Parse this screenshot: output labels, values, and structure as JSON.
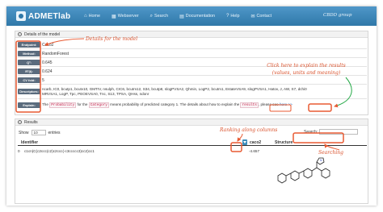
{
  "navbar": {
    "brand": "ADMETlab",
    "items": [
      {
        "icon": "home-icon",
        "glyph": "⌂",
        "label": "Home"
      },
      {
        "icon": "grid-icon",
        "glyph": "▦",
        "label": "Webserver"
      },
      {
        "icon": "search-icon",
        "glyph": "⌕",
        "label": "Search"
      },
      {
        "icon": "book-icon",
        "glyph": "▤",
        "label": "Documentation"
      },
      {
        "icon": "help-icon",
        "glyph": "?",
        "label": "Help"
      },
      {
        "icon": "contact-icon",
        "glyph": "✉",
        "label": "Contact"
      }
    ],
    "language": "CBDD group"
  },
  "details": {
    "header": "Details of the model",
    "rows": {
      "endpoint": {
        "label": "Endpoint:",
        "value": "Caco2"
      },
      "method": {
        "label": "Method:",
        "value": "RandomForest"
      },
      "q2": {
        "label": "Q²:",
        "value": "0.645"
      },
      "r2": {
        "label": "R²(t):",
        "value": "0.624"
      },
      "cv": {
        "label": "CV fold:",
        "value": "5"
      },
      "descriptors": {
        "label": "Descriptors:",
        "line1": "ncarb, IC0, bcutp1, bcutv10, GMTIV, nsulph, CIC6, bcutm12, S34, bcutp8, slogPVSA2, Qhmin, LogP2, bcutm1, EstateVSA9, slogPVSA1, Hatov, J, AW, S7, dchi0",
        "line2": "MRVSA1, LogP, Tpc, PEOEVSA0, Tnc, S13, TPSA, QHss, ndonr"
      },
      "explain": {
        "label": "Explain:",
        "part1": "The",
        "tag1": "Probability",
        "part2": "for the",
        "tag2": "Category",
        "part3": "means probability of predicted category 1. The details about how to explain the",
        "tag3": "results",
        "part4": ", please see",
        "link": "here >>"
      }
    }
  },
  "results": {
    "header": "Results",
    "show_label": "Show",
    "entries_value": "10",
    "entries_label": "entries",
    "search_label": "Search:",
    "search_value": "",
    "columns": {
      "identifier": "Identifier",
      "caco2": "caco2",
      "structure": "Structure"
    },
    "rows": [
      {
        "index": "0",
        "smiles": "c1cn(C(c2ccc(c2)c2ccc(-c3ccccc3)cc2)cc1",
        "caco2": "-4.657"
      }
    ]
  },
  "annotations": {
    "details_for_model": "Details for the model",
    "explain_results_line1": "Click here to explain the results",
    "explain_results_line2": "(values, units and meaning)",
    "ranking": "Ranking along columns",
    "searching": "Searching"
  },
  "colors": {
    "navbar": "#3c8dbc",
    "annotation": "#e85a32",
    "label_bg": "#5a6b7d"
  }
}
